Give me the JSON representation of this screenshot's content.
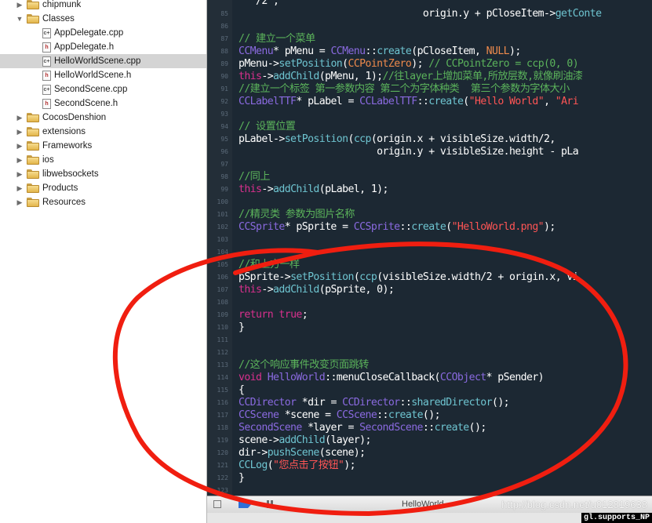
{
  "navigator": {
    "items": [
      {
        "label": "chipmunk",
        "kind": "folder",
        "expanded": false,
        "indent": 0,
        "selected": false
      },
      {
        "label": "Classes",
        "kind": "folder",
        "expanded": true,
        "indent": 0,
        "selected": false
      },
      {
        "label": "AppDelegate.cpp",
        "kind": "cpp",
        "indent": 1,
        "selected": false
      },
      {
        "label": "AppDelegate.h",
        "kind": "h",
        "indent": 1,
        "selected": false
      },
      {
        "label": "HelloWorldScene.cpp",
        "kind": "cpp",
        "indent": 1,
        "selected": true
      },
      {
        "label": "HelloWorldScene.h",
        "kind": "h",
        "indent": 1,
        "selected": false
      },
      {
        "label": "SecondScene.cpp",
        "kind": "cpp",
        "indent": 1,
        "selected": false
      },
      {
        "label": "SecondScene.h",
        "kind": "h",
        "indent": 1,
        "selected": false
      },
      {
        "label": "CocosDenshion",
        "kind": "folder",
        "expanded": false,
        "indent": 0,
        "selected": false
      },
      {
        "label": "extensions",
        "kind": "folder",
        "expanded": false,
        "indent": 0,
        "selected": false
      },
      {
        "label": "Frameworks",
        "kind": "folder",
        "expanded": false,
        "indent": 0,
        "selected": false
      },
      {
        "label": "ios",
        "kind": "folder",
        "expanded": false,
        "indent": 0,
        "selected": false
      },
      {
        "label": "libwebsockets",
        "kind": "folder",
        "expanded": false,
        "indent": 0,
        "selected": false
      },
      {
        "label": "Products",
        "kind": "folder",
        "expanded": false,
        "indent": 0,
        "selected": false
      },
      {
        "label": "Resources",
        "kind": "folder",
        "expanded": false,
        "indent": 0,
        "selected": false
      }
    ]
  },
  "editor": {
    "colors": {
      "background": "#1c2833",
      "keyword": "#d8308d",
      "type": "#8a6ae0",
      "function": "#6ec4d0",
      "string": "#ff5555",
      "comment": "#5bb35b",
      "macro": "#ee8a4c"
    },
    "lines": [
      {
        "n": "",
        "tokens": [
          [
            "p",
            "  \"/2\","
          ]
        ]
      },
      {
        "n": "85",
        "tokens": [
          [
            "p",
            "                                origin.y + pCloseItem->"
          ],
          [
            "f",
            "getConte"
          ]
        ]
      },
      {
        "n": "86",
        "tokens": []
      },
      {
        "n": "87",
        "tokens": [
          [
            "c",
            "// 建立一个菜单"
          ]
        ]
      },
      {
        "n": "88",
        "tokens": [
          [
            "t",
            "CCMenu"
          ],
          [
            "p",
            "* pMenu = "
          ],
          [
            "t",
            "CCMenu"
          ],
          [
            "p",
            "::"
          ],
          [
            "f",
            "create"
          ],
          [
            "p",
            "(pCloseItem, "
          ],
          [
            "m",
            "NULL"
          ],
          [
            "p",
            ");"
          ]
        ]
      },
      {
        "n": "89",
        "tokens": [
          [
            "p",
            "pMenu->"
          ],
          [
            "f",
            "setPosition"
          ],
          [
            "p",
            "("
          ],
          [
            "m",
            "CCPointZero"
          ],
          [
            "p",
            ");"
          ],
          [
            "c",
            " // CCPointZero = ccp(0, 0)"
          ]
        ]
      },
      {
        "n": "90",
        "tokens": [
          [
            "k",
            "this"
          ],
          [
            "p",
            "->"
          ],
          [
            "f",
            "addChild"
          ],
          [
            "p",
            "(pMenu, 1);"
          ],
          [
            "c",
            "//往layer上增加菜单,所放层数,就像刷油漆"
          ]
        ]
      },
      {
        "n": "91",
        "tokens": [
          [
            "c",
            "//建立一个标签 第一参数内容 第二个为字体种类  第三个参数为字体大小"
          ]
        ]
      },
      {
        "n": "92",
        "tokens": [
          [
            "t",
            "CCLabelTTF"
          ],
          [
            "p",
            "* pLabel = "
          ],
          [
            "t",
            "CCLabelTTF"
          ],
          [
            "p",
            "::"
          ],
          [
            "f",
            "create"
          ],
          [
            "p",
            "("
          ],
          [
            "s",
            "\"Hello World\""
          ],
          [
            "p",
            ", "
          ],
          [
            "s",
            "\"Ari"
          ]
        ]
      },
      {
        "n": "93",
        "tokens": []
      },
      {
        "n": "94",
        "tokens": [
          [
            "c",
            "// 设置位置"
          ]
        ]
      },
      {
        "n": "95",
        "tokens": [
          [
            "p",
            "pLabel->"
          ],
          [
            "f",
            "setPosition"
          ],
          [
            "p",
            "("
          ],
          [
            "f",
            "ccp"
          ],
          [
            "p",
            "(origin.x + visibleSize.width/2,"
          ]
        ]
      },
      {
        "n": "96",
        "tokens": [
          [
            "p",
            "                        origin.y + visibleSize.height - pLa"
          ]
        ]
      },
      {
        "n": "97",
        "tokens": []
      },
      {
        "n": "98",
        "tokens": [
          [
            "c",
            "//同上"
          ]
        ]
      },
      {
        "n": "99",
        "tokens": [
          [
            "k",
            "this"
          ],
          [
            "p",
            "->"
          ],
          [
            "f",
            "addChild"
          ],
          [
            "p",
            "(pLabel, 1);"
          ]
        ]
      },
      {
        "n": "100",
        "tokens": []
      },
      {
        "n": "101",
        "tokens": [
          [
            "c",
            "//精灵类 参数为图片名称"
          ]
        ]
      },
      {
        "n": "102",
        "tokens": [
          [
            "t",
            "CCSprite"
          ],
          [
            "p",
            "* pSprite = "
          ],
          [
            "t",
            "CCSprite"
          ],
          [
            "p",
            "::"
          ],
          [
            "f",
            "create"
          ],
          [
            "p",
            "("
          ],
          [
            "s",
            "\"HelloWorld.png\""
          ],
          [
            "p",
            ");"
          ]
        ]
      },
      {
        "n": "103",
        "tokens": []
      },
      {
        "n": "104",
        "tokens": []
      },
      {
        "n": "105",
        "tokens": [
          [
            "c",
            "//和上方一样"
          ]
        ]
      },
      {
        "n": "106",
        "tokens": [
          [
            "p",
            "pSprite->"
          ],
          [
            "f",
            "setPosition"
          ],
          [
            "p",
            "("
          ],
          [
            "f",
            "ccp"
          ],
          [
            "p",
            "(visibleSize.width/2 + origin.x, vi"
          ]
        ]
      },
      {
        "n": "107",
        "tokens": [
          [
            "k",
            "this"
          ],
          [
            "p",
            "->"
          ],
          [
            "f",
            "addChild"
          ],
          [
            "p",
            "(pSprite, 0);"
          ]
        ]
      },
      {
        "n": "108",
        "tokens": []
      },
      {
        "n": "109",
        "tokens": [
          [
            "k",
            "return"
          ],
          [
            "p",
            " "
          ],
          [
            "k",
            "true"
          ],
          [
            "p",
            ";"
          ]
        ]
      },
      {
        "n": "110",
        "tokens": [
          [
            "p",
            "}"
          ]
        ]
      },
      {
        "n": "111",
        "tokens": []
      },
      {
        "n": "112",
        "tokens": []
      },
      {
        "n": "113",
        "tokens": [
          [
            "c",
            "//这个响应事件改变页面跳转"
          ]
        ]
      },
      {
        "n": "114",
        "tokens": [
          [
            "k",
            "void"
          ],
          [
            "p",
            " "
          ],
          [
            "t",
            "HelloWorld"
          ],
          [
            "p",
            "::menuCloseCallback("
          ],
          [
            "t",
            "CCObject"
          ],
          [
            "p",
            "* pSender)"
          ]
        ]
      },
      {
        "n": "115",
        "tokens": [
          [
            "p",
            "{"
          ]
        ]
      },
      {
        "n": "116",
        "tokens": [
          [
            "t",
            "CCDirector"
          ],
          [
            "p",
            " *dir = "
          ],
          [
            "t",
            "CCDirector"
          ],
          [
            "p",
            "::"
          ],
          [
            "f",
            "sharedDirector"
          ],
          [
            "p",
            "();"
          ]
        ]
      },
      {
        "n": "117",
        "tokens": [
          [
            "t",
            "CCScene"
          ],
          [
            "p",
            " *scene = "
          ],
          [
            "t",
            "CCScene"
          ],
          [
            "p",
            "::"
          ],
          [
            "f",
            "create"
          ],
          [
            "p",
            "();"
          ]
        ]
      },
      {
        "n": "118",
        "tokens": [
          [
            "t",
            "SecondScene"
          ],
          [
            "p",
            " *layer = "
          ],
          [
            "t",
            "SecondScene"
          ],
          [
            "p",
            "::"
          ],
          [
            "f",
            "create"
          ],
          [
            "p",
            "();"
          ]
        ]
      },
      {
        "n": "119",
        "tokens": [
          [
            "p",
            "scene->"
          ],
          [
            "f",
            "addChild"
          ],
          [
            "p",
            "(layer);"
          ]
        ]
      },
      {
        "n": "120",
        "tokens": [
          [
            "p",
            "dir->"
          ],
          [
            "f",
            "pushScene"
          ],
          [
            "p",
            "(scene);"
          ]
        ]
      },
      {
        "n": "121",
        "tokens": [
          [
            "f",
            "CCLog"
          ],
          [
            "p",
            "("
          ],
          [
            "s",
            "\"您点击了按钮\""
          ],
          [
            "p",
            ");"
          ]
        ]
      },
      {
        "n": "122",
        "tokens": [
          [
            "p",
            "}"
          ]
        ]
      },
      {
        "n": "123",
        "tokens": []
      }
    ]
  },
  "debug_bar": {
    "scheme_label": "HelloWorld",
    "watermark": "http://blog.csdn.net/u012819638"
  },
  "status_bar": {
    "text": "gl.supports_NP"
  }
}
